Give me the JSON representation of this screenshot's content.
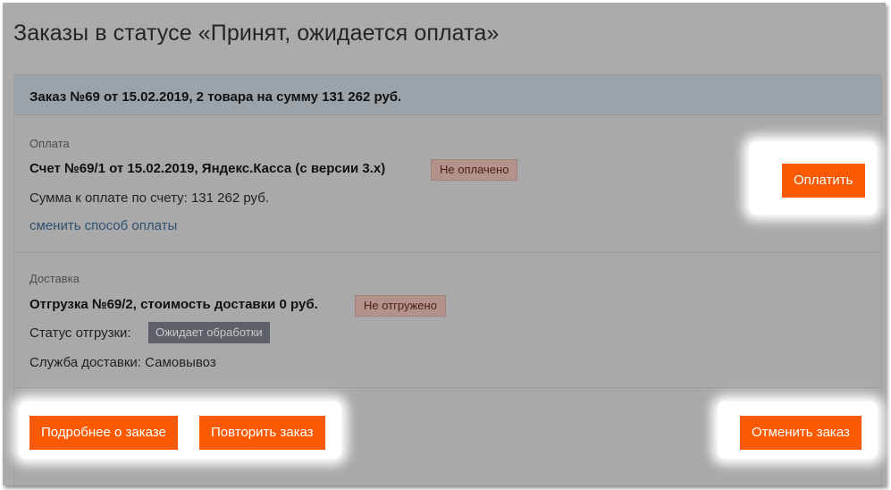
{
  "page": {
    "title": "Заказы в статусе «Принят, ожидается оплата»"
  },
  "order": {
    "header": "Заказ №69 от 15.02.2019, 2 товара на сумму 131 262 руб.",
    "payment": {
      "section_label": "Оплата",
      "invoice_title": "Счет №69/1 от 15.02.2019,  Яндекс.Касса (с версии 3.х)",
      "status_badge": "Не оплачено",
      "amount_text": "Сумма к оплате по счету: 131 262 руб.",
      "change_method_link": "сменить способ оплаты",
      "pay_button": "Оплатить"
    },
    "delivery": {
      "section_label": "Доставка",
      "shipment_title": "Отгрузка №69/2, стоимость доставки 0 руб.",
      "status_badge": "Не отгружено",
      "shipment_status_label": "Статус отгрузки:",
      "shipment_status_badge": "Ожидает обработки",
      "service_text": "Служба доставки: Самовывоз"
    },
    "actions": {
      "details_button": "Подробнее о заказе",
      "repeat_button": "Повторить заказ",
      "cancel_button": "Отменить заказ"
    }
  },
  "colors": {
    "accent": "#fb5a02",
    "overlay_background": "#ababab",
    "header_background": "#9ba3a8",
    "unpaid_badge": "#b3928c",
    "processing_badge": "#5b6069",
    "link": "#2e5070"
  }
}
